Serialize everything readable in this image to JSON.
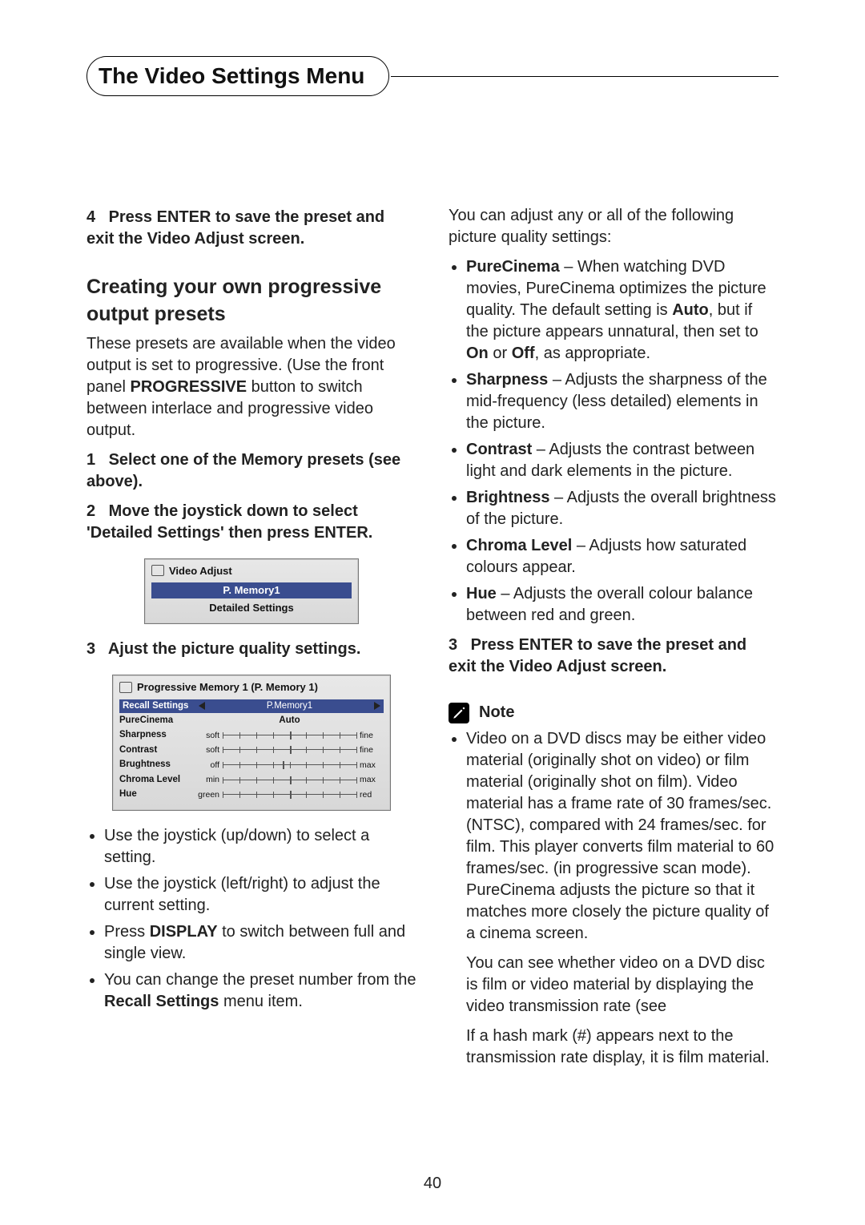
{
  "page_title": "The Video Settings Menu",
  "page_number": "40",
  "col_left": {
    "step4": {
      "num": "4",
      "text": "Press ENTER to save the preset and exit the Video Adjust screen."
    },
    "subhead": "Creating your own progressive output presets",
    "intro_1": "These presets are available when the video output is set to progressive. (Use the front panel ",
    "intro_bold": "PROGRESSIVE",
    "intro_2": " button to switch between interlace and progressive video output.",
    "step1": {
      "num": "1",
      "text": "Select one of the Memory presets (see above)."
    },
    "step2": {
      "num": "2",
      "text": "Move the joystick down to select 'Detailed Settings' then press ENTER."
    },
    "ui1": {
      "title": "Video Adjust",
      "line1": "P. Memory1",
      "line2": "Detailed Settings"
    },
    "step3": {
      "num": "3",
      "text": "Ajust the picture quality settings."
    },
    "ui2": {
      "title": "Progressive Memory 1 (P. Memory 1)",
      "recall": "Recall Settings",
      "recall_val": "P.Memory1",
      "rows": [
        {
          "label": "PureCinema",
          "mode": "text",
          "value": "Auto"
        },
        {
          "label": "Sharpness",
          "mode": "slider",
          "lt": "soft",
          "rt": "fine",
          "pos": 50
        },
        {
          "label": "Contrast",
          "mode": "slider",
          "lt": "soft",
          "rt": "fine",
          "pos": 50
        },
        {
          "label": "Brughtness",
          "mode": "slider",
          "lt": "off",
          "rt": "max",
          "pos": 45
        },
        {
          "label": "Chroma Level",
          "mode": "slider",
          "lt": "min",
          "rt": "max",
          "pos": 50
        },
        {
          "label": "Hue",
          "mode": "slider",
          "lt": "green",
          "rt": "red",
          "pos": 50
        }
      ]
    },
    "bullets_after_ui2": [
      {
        "pre": "Use the joystick (up/down) to select a setting."
      },
      {
        "pre": "Use the joystick (left/right) to adjust the current setting."
      },
      {
        "pre": "Press ",
        "bold": "DISPLAY",
        "post": " to switch between full and single view."
      },
      {
        "pre": "You can change the preset number from the ",
        "bold": "Recall Settings",
        "post": " menu item."
      }
    ]
  },
  "col_right": {
    "lead": "You can adjust any or all of the following picture quality settings:",
    "settings": [
      {
        "name": "PureCinema",
        "desc_1": " – When watching DVD movies, PureCinema optimizes the picture quality. The default setting is ",
        "b1": "Auto",
        "desc_2": ", but if the picture appears unnatural, then set to ",
        "b2": "On",
        "desc_3": " or ",
        "b3": "Off",
        "desc_4": ", as appropriate."
      },
      {
        "name": "Sharpness",
        "desc": " – Adjusts the sharpness of the mid-frequency (less detailed) elements in the picture."
      },
      {
        "name": "Contrast",
        "desc": " – Adjusts the contrast between light and dark elements in the picture."
      },
      {
        "name": "Brightness",
        "desc": " – Adjusts the overall brightness of the picture."
      },
      {
        "name": "Chroma Level",
        "desc": " – Adjusts how saturated colours appear."
      },
      {
        "name": "Hue",
        "desc": " – Adjusts the overall colour balance between red and green."
      }
    ],
    "step3": {
      "num": "3",
      "text": "Press ENTER to save the preset and exit the Video Adjust screen."
    },
    "note_label": "Note",
    "note_bullet_1": "Video on a DVD discs may be either video material (originally shot on video) or film material (originally shot on film). Video material has a frame rate of 30 frames/sec.(NTSC), compared with 24 frames/sec. for film. This player converts film material to 60 frames/sec. (in progressive scan mode). PureCinema adjusts the picture so that it matches more closely the picture quality of a cinema screen.",
    "note_para_2a": "You can see whether video on a DVD disc is film or video material by displaying the video transmission rate (see",
    "note_para_2b": "If a hash mark (#) appears next to the transmission rate display, it is film material."
  }
}
